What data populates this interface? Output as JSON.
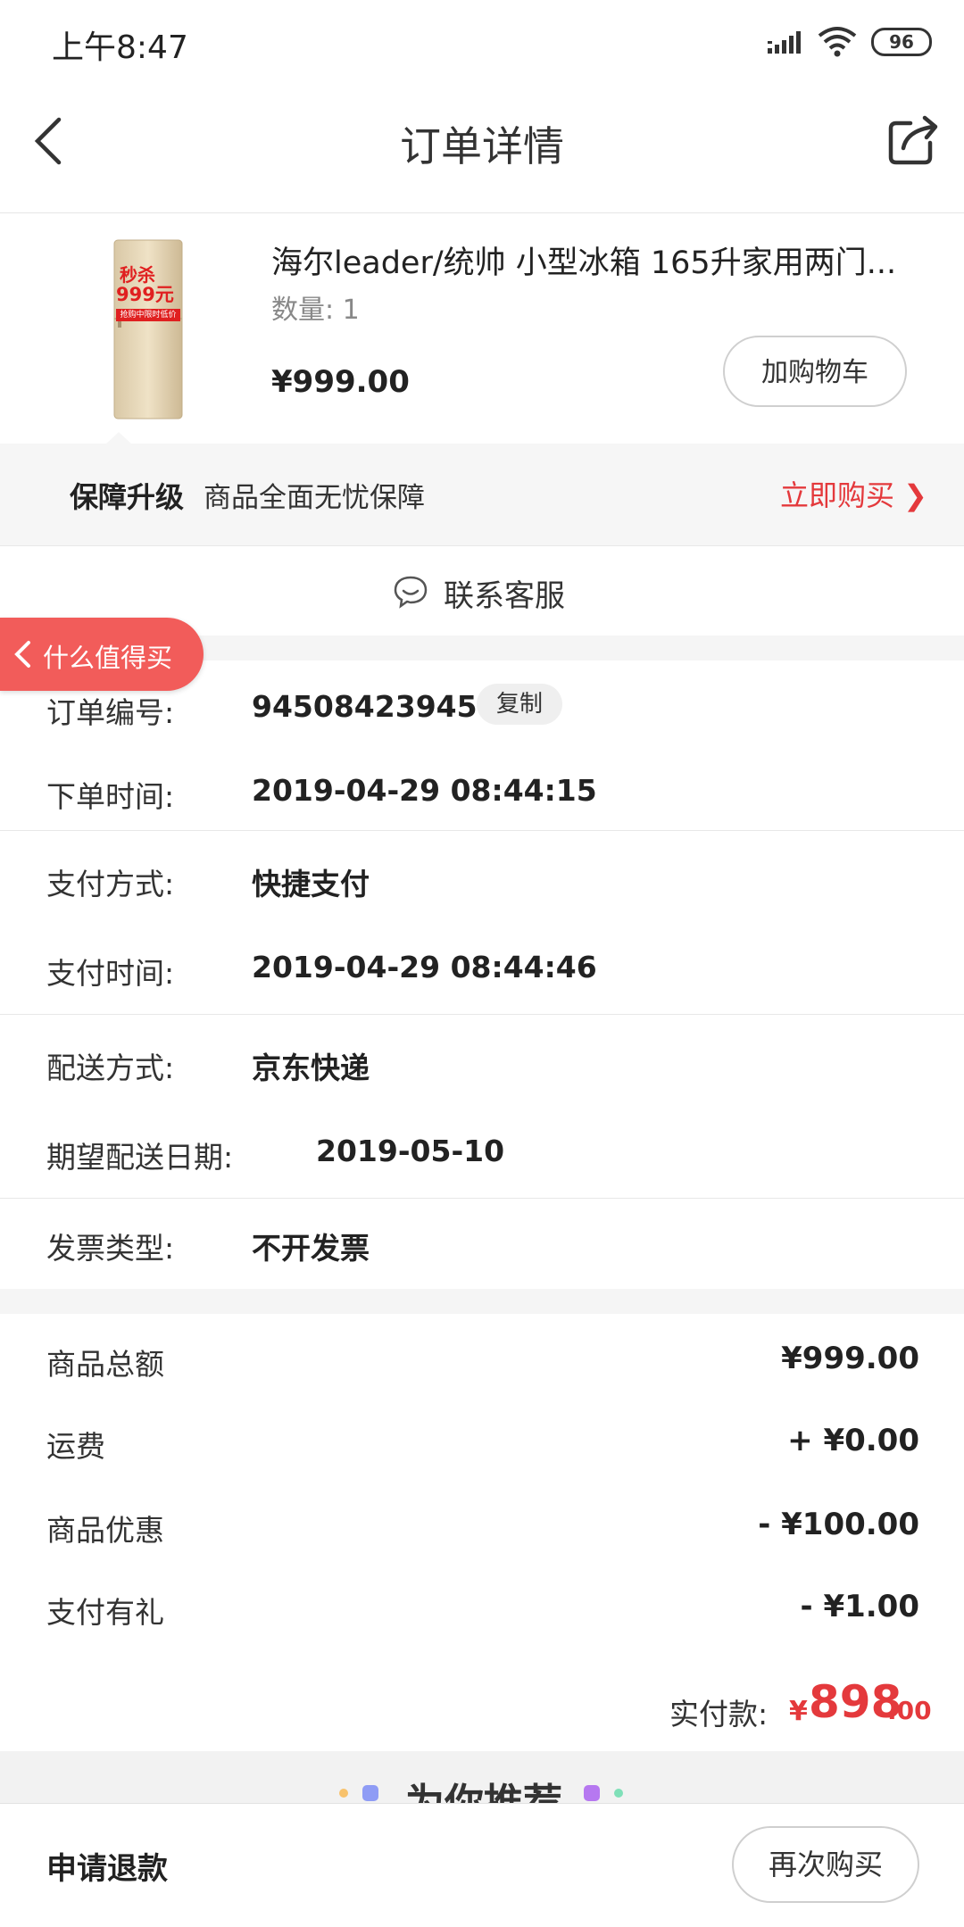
{
  "status_bar": {
    "time": "上午8:47",
    "battery": "96",
    "icons": [
      "signal-icon",
      "wifi-icon",
      "battery-icon"
    ]
  },
  "header": {
    "title": "订单详情",
    "icons": [
      "back-icon",
      "share-icon"
    ]
  },
  "product": {
    "title": "海尔leader/统帅 小型冰箱 165升家用两门...",
    "quantity": "数量: 1",
    "price": "¥999.00",
    "add_cart_label": "加购物车",
    "image_badge_top": "秒杀",
    "image_badge_price": "999元",
    "image_badge_sub": "抢购中限时低价"
  },
  "protection": {
    "label": "保障升级",
    "description": "商品全面无忧保障",
    "cta": "立即购买 ❯"
  },
  "contact": {
    "label": "联系客服",
    "icon": "chat-icon"
  },
  "floating_badge": {
    "label": "什么值得买",
    "icon": "chevron-left-icon"
  },
  "order_info": {
    "order_no_label": "订单编号:",
    "order_no": "94508423945",
    "copy_label": "复制",
    "order_time_label": "下单时间:",
    "order_time": "2019-04-29 08:44:15",
    "pay_method_label": "支付方式:",
    "pay_method": "快捷支付",
    "pay_time_label": "支付时间:",
    "pay_time": "2019-04-29 08:44:46",
    "delivery_method_label": "配送方式:",
    "delivery_method": "京东快递",
    "expected_date_label": "期望配送日期:",
    "expected_date": "2019-05-10",
    "invoice_label": "发票类型:",
    "invoice": "不开发票"
  },
  "amounts": {
    "goods_total_label": "商品总额",
    "goods_total": "¥999.00",
    "shipping_label": "运费",
    "shipping": "+ ¥0.00",
    "discount_label": "商品优惠",
    "discount": "- ¥100.00",
    "gift_label": "支付有礼",
    "gift": "- ¥1.00",
    "paid_label": "实付款:",
    "paid_currency": "¥",
    "paid_int": "898",
    "paid_dec": ".00"
  },
  "recommend": {
    "title": "为你推荐"
  },
  "bottom": {
    "refund_label": "申请退款",
    "rebuy_label": "再次购买"
  },
  "colors": {
    "accent_red": "#e4393c",
    "badge_red": "#f25c5a"
  }
}
